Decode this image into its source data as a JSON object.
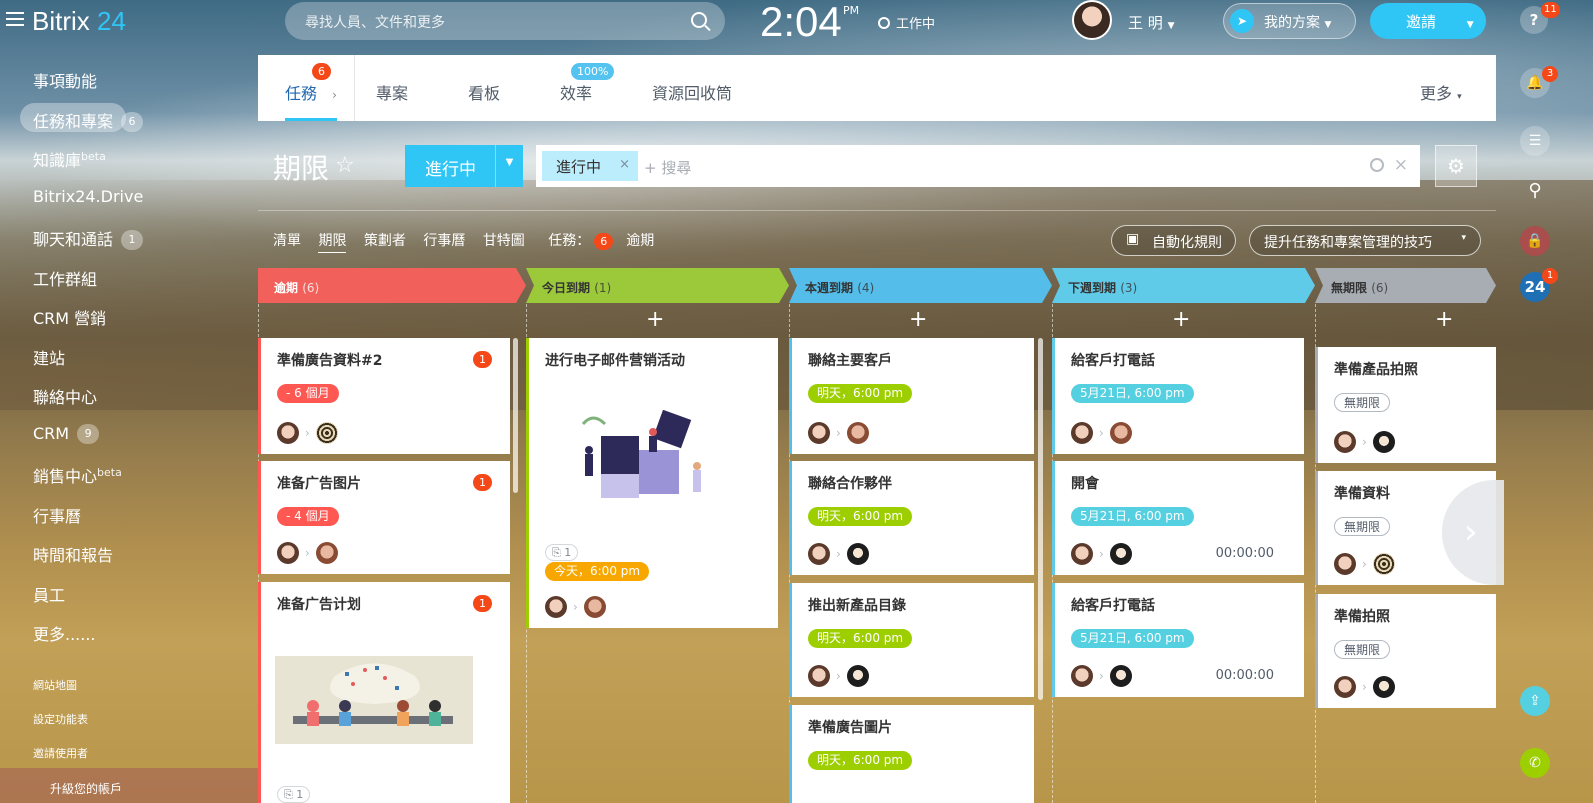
{
  "app": {
    "logo_main": "Bitrix",
    "logo_num": "24"
  },
  "header": {
    "search_placeholder": "尋找人員、文件和更多",
    "time": "2:04",
    "ampm": "PM",
    "work_status": "工作中",
    "user_name": "王 明",
    "plan_label": "我的方案",
    "invite_label": "邀請",
    "help_badge": "11"
  },
  "left_menu": {
    "items": [
      {
        "label": "事項動能"
      },
      {
        "label": "任務和專案",
        "count": "6"
      },
      {
        "label": "知識庫",
        "sup": "beta"
      },
      {
        "label": "Bitrix24.Drive"
      },
      {
        "label": "聊天和通話",
        "count": "1"
      },
      {
        "label": "工作群組"
      },
      {
        "label": "CRM 營銷"
      },
      {
        "label": "建站"
      },
      {
        "label": "聯絡中心"
      },
      {
        "label": "CRM",
        "count": "9"
      },
      {
        "label": "銷售中心",
        "sup": "beta"
      },
      {
        "label": "行事曆"
      },
      {
        "label": "時間和報告"
      },
      {
        "label": "員工"
      },
      {
        "label": "更多......"
      }
    ],
    "sitemap": "網站地圖",
    "settings": "設定功能表",
    "invite_users": "邀請使用者",
    "upgrade": "升級您的帳戶"
  },
  "tabs": [
    {
      "label": "任務",
      "badge": "6"
    },
    {
      "label": "專案"
    },
    {
      "label": "看板"
    },
    {
      "label": "效率",
      "badge": "100%"
    },
    {
      "label": "資源回收筒"
    }
  ],
  "tabs_more": "更多",
  "page": {
    "title": "期限",
    "status_button": "進行中",
    "filter_chip": "進行中",
    "filter_placeholder": "+ 搜尋"
  },
  "views": {
    "items": [
      "清單",
      "期限",
      "策劃者",
      "行事曆",
      "甘特圖"
    ],
    "tasks_label": "任務：",
    "overdue_count": "6",
    "overdue_label": "逾期",
    "automation": "自動化規則",
    "tips": "提升任務和專案管理的技巧"
  },
  "rail": {
    "bell_badge": "3",
    "b24_badge": "1",
    "b24_label": "24"
  },
  "columns": [
    {
      "title": "逾期",
      "count": "(6)",
      "color": "#f1605a"
    },
    {
      "title": "今日到期",
      "count": "(1)",
      "color": "#9cc93a"
    },
    {
      "title": "本週到期",
      "count": "(4)",
      "color": "#55bde9"
    },
    {
      "title": "下週到期",
      "count": "(3)",
      "color": "#60cbe8"
    },
    {
      "title": "無期限",
      "count": "(6)",
      "color": "#a8adb4"
    }
  ],
  "cards": {
    "c1": {
      "title": "準備廣告資料#2",
      "notif": "1",
      "deadline": "- 6 個月"
    },
    "c2": {
      "title": "准备广告图片",
      "notif": "1",
      "deadline": "- 4 個月"
    },
    "c3": {
      "title": "准备广告计划",
      "notif": "1",
      "attach": "1"
    },
    "c4": {
      "title": "进行电子邮件营销活动",
      "attach": "1",
      "deadline": "今天，6:00 pm"
    },
    "c5": {
      "title": "聯絡主要客戶",
      "deadline": "明天，6:00 pm"
    },
    "c6": {
      "title": "聯絡合作夥伴",
      "deadline": "明天，6:00 pm"
    },
    "c7": {
      "title": "推出新產品目錄",
      "deadline": "明天，6:00 pm"
    },
    "c8": {
      "title": "準備廣告圖片",
      "deadline": "明天，6:00 pm"
    },
    "c9": {
      "title": "給客戶打電話",
      "deadline": "5月21日, 6:00 pm"
    },
    "c10": {
      "title": "開會",
      "deadline": "5月21日, 6:00 pm",
      "timer": "00:00:00"
    },
    "c11": {
      "title": "給客戶打電話",
      "deadline": "5月21日, 6:00 pm",
      "timer": "00:00:00"
    },
    "c12": {
      "title": "準備產品拍照",
      "deadline": "無期限"
    },
    "c13": {
      "title": "準備資料",
      "deadline": "無期限"
    },
    "c14": {
      "title": "準備拍照",
      "deadline": "無期限"
    }
  }
}
